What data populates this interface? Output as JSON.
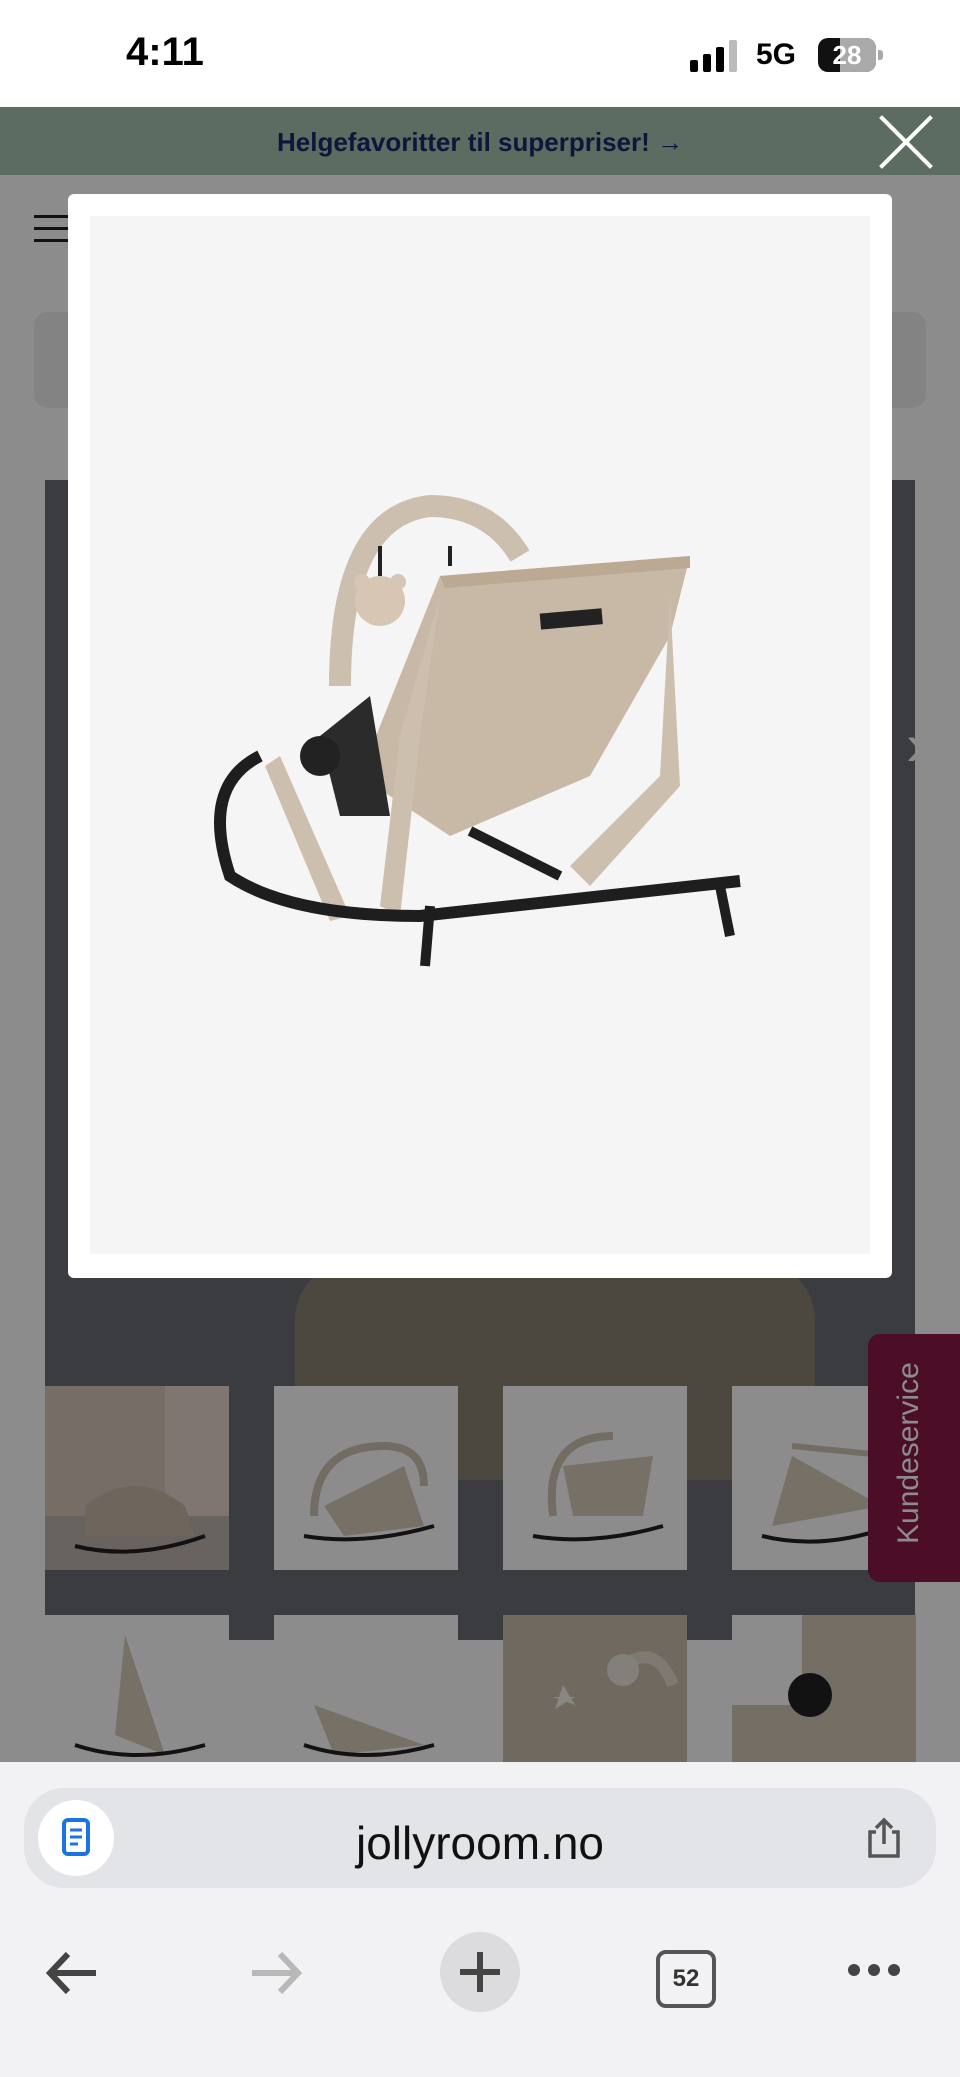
{
  "status_bar": {
    "time": "4:11",
    "network": "5G",
    "battery": "28"
  },
  "promo_banner": {
    "text": "Helgefavoritter til superpriser! →"
  },
  "side_tab": {
    "label": "Kundeservice"
  },
  "modal": {
    "image_alt": "Vippestol sett bakfra"
  },
  "thumbnails": [
    {
      "label": "photo-1"
    },
    {
      "label": "photo-2"
    },
    {
      "label": "photo-3"
    },
    {
      "label": "photo-4"
    },
    {
      "label": "photo-5"
    },
    {
      "label": "photo-6"
    },
    {
      "label": "photo-7"
    },
    {
      "label": "photo-8"
    }
  ],
  "browser": {
    "url": "jollyroom.no",
    "tab_count": "52"
  },
  "colors": {
    "promo_bg": "#a8c5b0",
    "promo_text": "#1a2a6c",
    "kundeservice_bg": "#8a1845"
  }
}
